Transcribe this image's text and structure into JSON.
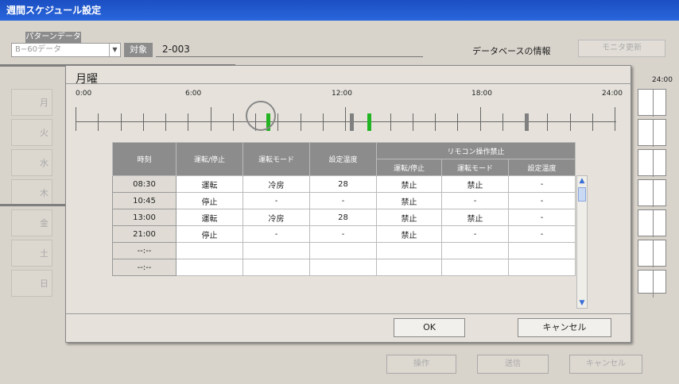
{
  "window": {
    "title": "週間スケジュール設定"
  },
  "pattern": {
    "label": "パターンデータ",
    "value": "B−60データ"
  },
  "target": {
    "label": "対象",
    "value": "2-003"
  },
  "database": {
    "label": "データベースの情報"
  },
  "buttons": {
    "monitor": "モニタ更新",
    "ok": "OK",
    "cancel": "キャンセル",
    "operate": "操作",
    "send": "送信",
    "bottom_cancel": "キャンセル"
  },
  "weekdays": [
    "月",
    "火",
    "水",
    "木",
    "金",
    "土",
    "日"
  ],
  "right_axis_label": "24:00",
  "panel": {
    "title": "月曜"
  },
  "timeline": {
    "labels": [
      "0:00",
      "6:00",
      "12:00",
      "18:00",
      "24:00"
    ]
  },
  "table": {
    "headers": {
      "time": "時刻",
      "run_stop": "運転/停止",
      "mode": "運転モード",
      "set_temp": "設定温度",
      "remote_group": "リモコン操作禁止",
      "remote_run_stop": "運転/停止",
      "remote_mode": "運転モード",
      "remote_temp": "設定温度"
    },
    "rows": [
      [
        "08:30",
        "運転",
        "冷房",
        "28",
        "禁止",
        "禁止",
        "-"
      ],
      [
        "10:45",
        "停止",
        "-",
        "-",
        "禁止",
        "-",
        "-"
      ],
      [
        "13:00",
        "運転",
        "冷房",
        "28",
        "禁止",
        "禁止",
        "-"
      ],
      [
        "21:00",
        "停止",
        "-",
        "-",
        "禁止",
        "-",
        "-"
      ],
      [
        "--:--",
        "",
        "",
        "",
        "",
        "",
        ""
      ],
      [
        "--:--",
        "",
        "",
        "",
        "",
        "",
        ""
      ]
    ]
  },
  "colors": {
    "titlebar": "#1f57cc",
    "marker_on": "#22b422",
    "marker_off": "#808080"
  },
  "icons": {
    "scroll_up": "arrow-up-icon",
    "scroll_down": "arrow-down-icon",
    "dropdown": "chevron-down-icon"
  }
}
